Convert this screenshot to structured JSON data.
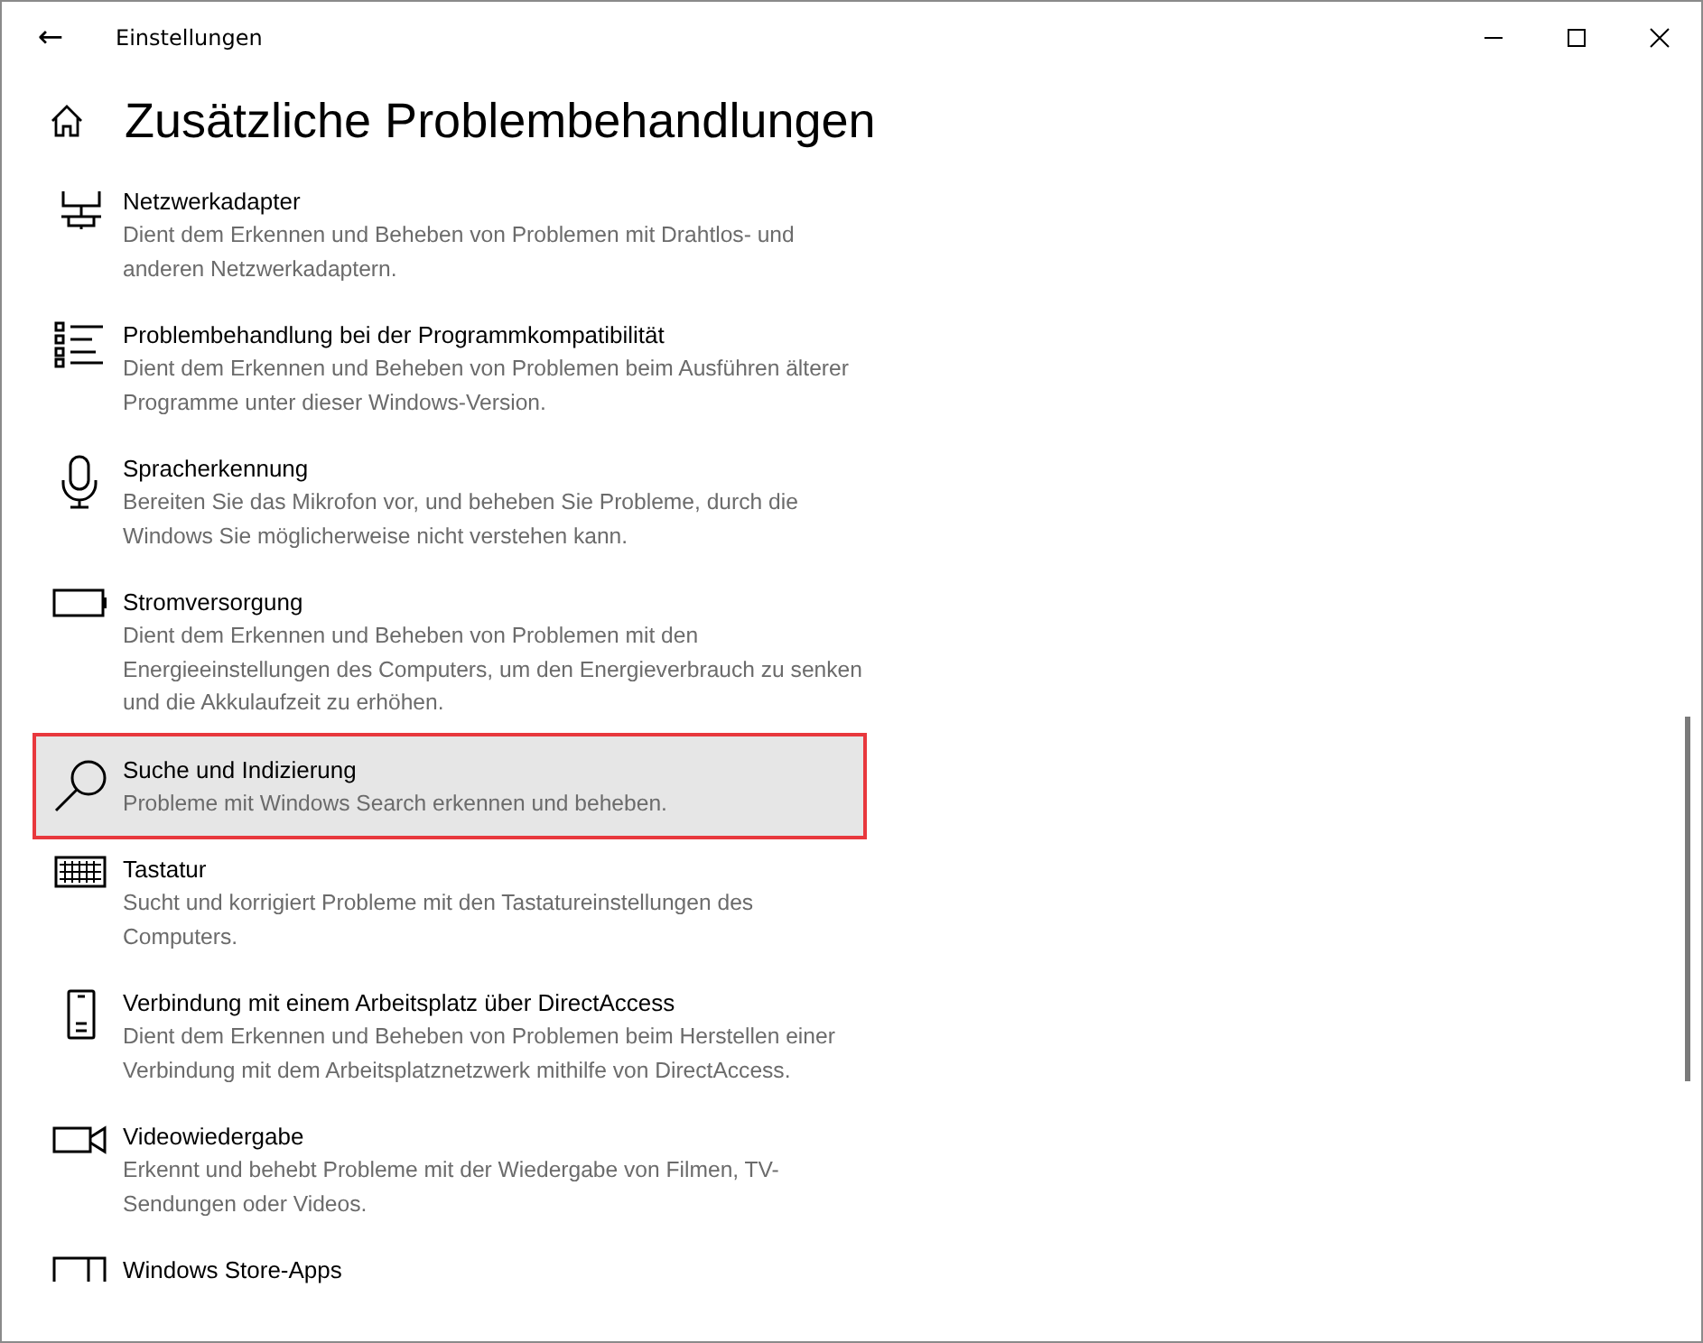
{
  "window": {
    "title": "Einstellungen",
    "back": "←"
  },
  "page": {
    "title": "Zusätzliche Problembehandlungen"
  },
  "items": [
    {
      "kind": "network",
      "title": "Netzwerkadapter",
      "description": "Dient dem Erkennen und Beheben von Problemen mit Drahtlos- und anderen Netzwerkadaptern.",
      "selected": false
    },
    {
      "kind": "list",
      "title": "Problembehandlung bei der Programmkompatibilität",
      "description": "Dient dem Erkennen und Beheben von Problemen beim Ausführen älterer Programme unter dieser Windows-Version.",
      "selected": false
    },
    {
      "kind": "mic",
      "title": "Spracherkennung",
      "description": "Bereiten Sie das Mikrofon vor, und beheben Sie Probleme, durch die Windows Sie möglicherweise nicht verstehen kann.",
      "selected": false
    },
    {
      "kind": "battery",
      "title": "Stromversorgung",
      "description": "Dient dem Erkennen und Beheben von Problemen mit den Energieeinstellungen des Computers, um den Energieverbrauch zu senken und die Akkulaufzeit zu erhöhen.",
      "selected": false
    },
    {
      "kind": "search",
      "title": "Suche und Indizierung",
      "description": "Probleme mit Windows Search erkennen und beheben.",
      "selected": true
    },
    {
      "kind": "keyboard",
      "title": "Tastatur",
      "description": "Sucht und korrigiert Probleme mit den Tastatureinstellungen des Computers.",
      "selected": false
    },
    {
      "kind": "phone",
      "title": "Verbindung mit einem Arbeitsplatz über DirectAccess",
      "description": "Dient dem Erkennen und Beheben von Problemen beim Herstellen einer Verbindung mit dem Arbeitsplatznetzwerk mithilfe von DirectAccess.",
      "selected": false
    },
    {
      "kind": "video",
      "title": "Videowiedergabe",
      "description": "Erkennt und behebt Probleme mit der Wiedergabe von Filmen, TV-Sendungen oder Videos.",
      "selected": false
    },
    {
      "kind": "store",
      "title": "Windows Store-Apps",
      "selected": false
    }
  ]
}
